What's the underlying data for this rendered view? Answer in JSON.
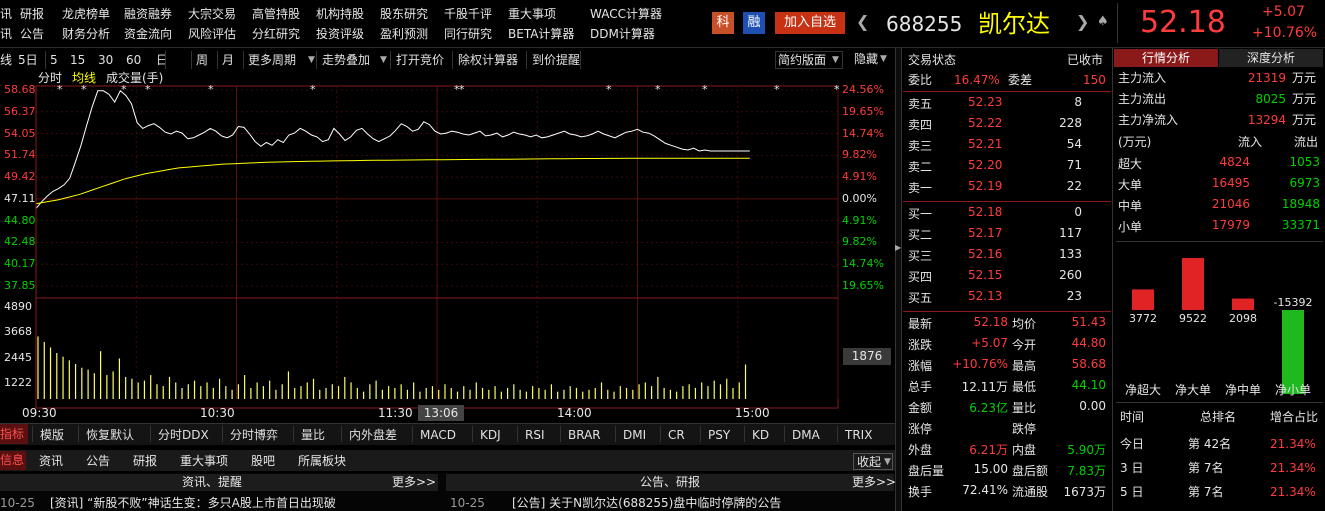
{
  "menu_row1": [
    "研报",
    "龙虎榜单",
    "融资融券",
    "大宗交易",
    "高管持股",
    "机构持股",
    "股东研究",
    "千股千评",
    "重大事项",
    "WACC计算器"
  ],
  "menu_row2": [
    "公告",
    "财务分析",
    "资金流向",
    "风险评估",
    "分红研究",
    "投资评级",
    "盈利预测",
    "同行研究",
    "BETA计算器",
    "DDM计算器"
  ],
  "edge_chars": {
    "row1": "讯",
    "row2": "讯",
    "toolbar": "线",
    "tabs": "指标",
    "bottom": "信息"
  },
  "badges": {
    "ke": "科",
    "rong": "融"
  },
  "add_watch": "加入自选",
  "stock": {
    "code": "688255",
    "name": "凯尔达",
    "price": "52.18",
    "change": "+5.07",
    "change_pct": "+10.76%"
  },
  "toolbar": [
    "5日",
    "5",
    "15",
    "30",
    "60",
    "日",
    "周",
    "月",
    "更多周期",
    "走势叠加",
    "打开竞价",
    "除权计算器",
    "到价提醒"
  ],
  "toolbar_right": [
    "简约版面",
    "隐藏"
  ],
  "chart": {
    "legend": [
      "分时",
      "均线",
      "成交量(手)"
    ],
    "left_prices": [
      "58.68",
      "56.37",
      "54.05",
      "51.74",
      "49.42",
      "47.11",
      "44.80",
      "42.48",
      "40.17",
      "37.85"
    ],
    "right_pcts": [
      "24.56%",
      "19.65%",
      "14.74%",
      "9.82%",
      "4.91%",
      "0.00%",
      "4.91%",
      "9.82%",
      "14.74%",
      "19.65%"
    ],
    "vol_labels": [
      "4890",
      "3668",
      "2445",
      "1222"
    ],
    "vol_badge": "1876",
    "times": [
      "09:30",
      "10:30",
      "11:30",
      "14:00",
      "15:00"
    ],
    "cursor_time": "13:06",
    "price_line": [
      46.1,
      46.8,
      47.4,
      47.9,
      48.2,
      48.6,
      49.3,
      51.0,
      52.8,
      54.9,
      56.9,
      58.6,
      58.6,
      58.2,
      57.4,
      58.6,
      58.1,
      57.2,
      55.2,
      54.6,
      54.9,
      55.1,
      54.7,
      54.2,
      54.0,
      54.3,
      54.1,
      53.5,
      53.6,
      53.9,
      54.2,
      54.6,
      54.3,
      53.8,
      53.6,
      53.9,
      54.8,
      54.7,
      54.0,
      53.2,
      52.7,
      53.1,
      52.8,
      53.4,
      53.1,
      53.9,
      54.1,
      54.6,
      54.3,
      53.9,
      53.7,
      53.2,
      53.4,
      54.6,
      54.0,
      53.3,
      53.7,
      54.4,
      54.6,
      54.0,
      53.5,
      53.2,
      53.5,
      53.8,
      54.4,
      55.1,
      54.8,
      54.3,
      54.5,
      55.3,
      55.0,
      54.3,
      54.0,
      54.1,
      54.3,
      54.2,
      54.0,
      53.9,
      54.1,
      54.3,
      53.8,
      53.9,
      54.1,
      53.7,
      53.9,
      54.2,
      54.0,
      53.9,
      53.7,
      53.9,
      53.6,
      53.7,
      53.9,
      54.1,
      54.3,
      54.0,
      53.9,
      53.7,
      53.8,
      54.0,
      54.3,
      54.0,
      53.8,
      53.6,
      53.9,
      54.2,
      54.3,
      54.5,
      54.2,
      54.1,
      53.8,
      53.4,
      53.0,
      52.8,
      52.6,
      52.4,
      52.3,
      52.5,
      52.2,
      52.3,
      52.2,
      52.2,
      52.2,
      52.2,
      52.2,
      52.2,
      52.2,
      52.2
    ],
    "avg_line": [
      46.6,
      46.8,
      47.0,
      47.3,
      47.6,
      48.0,
      48.4,
      48.8,
      49.2,
      49.5,
      49.8,
      50.0,
      50.2,
      50.4,
      50.5,
      50.6,
      50.7,
      50.8,
      50.85,
      50.9,
      50.95,
      51.0,
      51.03,
      51.06,
      51.08,
      51.1,
      51.12,
      51.14,
      51.16,
      51.18,
      51.2,
      51.21,
      51.22,
      51.23,
      51.24,
      51.25,
      51.26,
      51.27,
      51.28,
      51.29,
      51.3,
      51.31,
      51.32,
      51.33,
      51.34,
      51.35,
      51.36,
      51.37,
      51.38,
      51.39,
      51.4,
      51.4,
      51.41,
      51.41,
      51.42,
      51.42,
      51.42,
      51.43,
      51.43,
      51.43,
      51.43,
      51.43,
      51.43,
      51.43,
      51.43,
      51.43
    ],
    "volumes": [
      3400,
      3100,
      2800,
      2500,
      2300,
      2100,
      1900,
      1700,
      1600,
      1400,
      2600,
      1300,
      1500,
      2200,
      1200,
      1100,
      900,
      1000,
      1300,
      800,
      700,
      1200,
      900,
      600,
      800,
      1000,
      700,
      900,
      600,
      1100,
      700,
      500,
      800,
      1300,
      600,
      900,
      700,
      1000,
      500,
      800,
      1500,
      600,
      700,
      900,
      1100,
      500,
      600,
      800,
      700,
      1200,
      900,
      600,
      400,
      800,
      1000,
      500,
      700,
      600,
      800,
      500,
      900,
      400,
      600,
      700,
      500,
      800,
      600,
      400,
      700,
      500,
      900,
      600,
      500,
      700,
      400,
      600,
      800,
      500,
      400,
      700,
      600,
      500,
      800,
      400,
      500,
      700,
      600,
      400,
      500,
      600,
      900,
      500,
      400,
      700,
      600,
      500,
      800,
      900,
      700,
      1200,
      600,
      500,
      400,
      700,
      800,
      600,
      900,
      700,
      1000,
      800,
      1100,
      600,
      900,
      1876
    ]
  },
  "bottom_tabs": [
    "模版",
    "恢复默认",
    "分时DDX",
    "分时博弈",
    "量比",
    "内外盘差",
    "MACD",
    "KDJ",
    "RSI",
    "BRAR",
    "DMI",
    "CR",
    "PSY",
    "KD",
    "DMA",
    "TRIX"
  ],
  "info_tabs": [
    "资讯",
    "公告",
    "研报",
    "重大事项",
    "股吧",
    "所属板块"
  ],
  "collapse_label": "收起",
  "news_left": {
    "header": "资讯、提醒",
    "more": "更多>>",
    "item_date": "10-25",
    "item_text": "[资讯] “新股不败”神话生变：多只A股上市首日出现破"
  },
  "news_right": {
    "header": "公告、研报",
    "more": "更多>>",
    "item_date": "10-25",
    "item_text": "[公告] 关于N凯尔达(688255)盘中临时停牌的公告"
  },
  "orderbook": {
    "status_label": "交易状态",
    "status_value": "已收市",
    "weibi_label": "委比",
    "weibi_value": "16.47%",
    "weicha_label": "委差",
    "weicha_value": "150",
    "asks": [
      {
        "label": "卖五",
        "price": "52.23",
        "vol": "8"
      },
      {
        "label": "卖四",
        "price": "52.22",
        "vol": "228"
      },
      {
        "label": "卖三",
        "price": "52.21",
        "vol": "54"
      },
      {
        "label": "卖二",
        "price": "52.20",
        "vol": "71"
      },
      {
        "label": "卖一",
        "price": "52.19",
        "vol": "22"
      }
    ],
    "bids": [
      {
        "label": "买一",
        "price": "52.18",
        "vol": "0"
      },
      {
        "label": "买二",
        "price": "52.17",
        "vol": "117"
      },
      {
        "label": "买三",
        "price": "52.16",
        "vol": "133"
      },
      {
        "label": "买四",
        "price": "52.15",
        "vol": "260"
      },
      {
        "label": "买五",
        "price": "52.13",
        "vol": "23"
      }
    ],
    "stats": [
      {
        "l1": "最新",
        "v1": "52.18",
        "c1": "red",
        "l2": "均价",
        "v2": "51.43",
        "c2": "red"
      },
      {
        "l1": "涨跌",
        "v1": "+5.07",
        "c1": "red",
        "l2": "今开",
        "v2": "44.80",
        "c2": "red"
      },
      {
        "l1": "涨幅",
        "v1": "+10.76%",
        "c1": "red",
        "l2": "最高",
        "v2": "58.68",
        "c2": "red"
      },
      {
        "l1": "总手",
        "v1": "12.11万",
        "c1": "white",
        "l2": "最低",
        "v2": "44.10",
        "c2": "green"
      },
      {
        "l1": "金额",
        "v1": "6.23亿",
        "c1": "green",
        "l2": "量比",
        "v2": "0.00",
        "c2": "white"
      },
      {
        "l1": "涨停",
        "v1": "",
        "c1": "white",
        "l2": "跌停",
        "v2": "",
        "c2": "white"
      },
      {
        "l1": "外盘",
        "v1": "6.21万",
        "c1": "red",
        "l2": "内盘",
        "v2": "5.90万",
        "c2": "green"
      },
      {
        "l1": "盘后量",
        "v1": "15.00",
        "c1": "white",
        "l2": "盘后额",
        "v2": "7.83万",
        "c2": "green"
      },
      {
        "l1": "换手",
        "v1": "72.41%",
        "c1": "white",
        "l2": "流通股",
        "v2": "1673万",
        "c2": "white"
      }
    ]
  },
  "flow": {
    "tabs": [
      "行情分析",
      "深度分析"
    ],
    "inflow_label": "主力流入",
    "inflow_value": "21319",
    "inflow_unit": "万元",
    "outflow_label": "主力流出",
    "outflow_value": "8025",
    "outflow_unit": "万元",
    "net_label": "主力净流入",
    "net_value": "13294",
    "net_unit": "万元",
    "table_header": [
      "(万元)",
      "流入",
      "流出"
    ],
    "rows": [
      {
        "label": "超大",
        "in": "4824",
        "out": "1053"
      },
      {
        "label": "大单",
        "in": "16495",
        "out": "6973"
      },
      {
        "label": "中单",
        "in": "21046",
        "out": "18948"
      },
      {
        "label": "小单",
        "in": "17979",
        "out": "33371"
      }
    ],
    "bars": [
      {
        "label": "净超大",
        "value": 3772
      },
      {
        "label": "净大单",
        "value": 9522
      },
      {
        "label": "净中单",
        "value": 2098
      },
      {
        "label": "净小单",
        "value": -15392
      }
    ],
    "bar_text": [
      "3772",
      "9522",
      "2098",
      "-15392"
    ],
    "ranking_header": [
      "时间",
      "总排名",
      "增合占比"
    ],
    "ranking": [
      {
        "t": "今日",
        "r": "第 42名",
        "p": "21.34%"
      },
      {
        "t": "3 日",
        "r": "第 7名",
        "p": "21.34%"
      },
      {
        "t": "5 日",
        "r": "第 7名",
        "p": "21.34%"
      }
    ]
  }
}
